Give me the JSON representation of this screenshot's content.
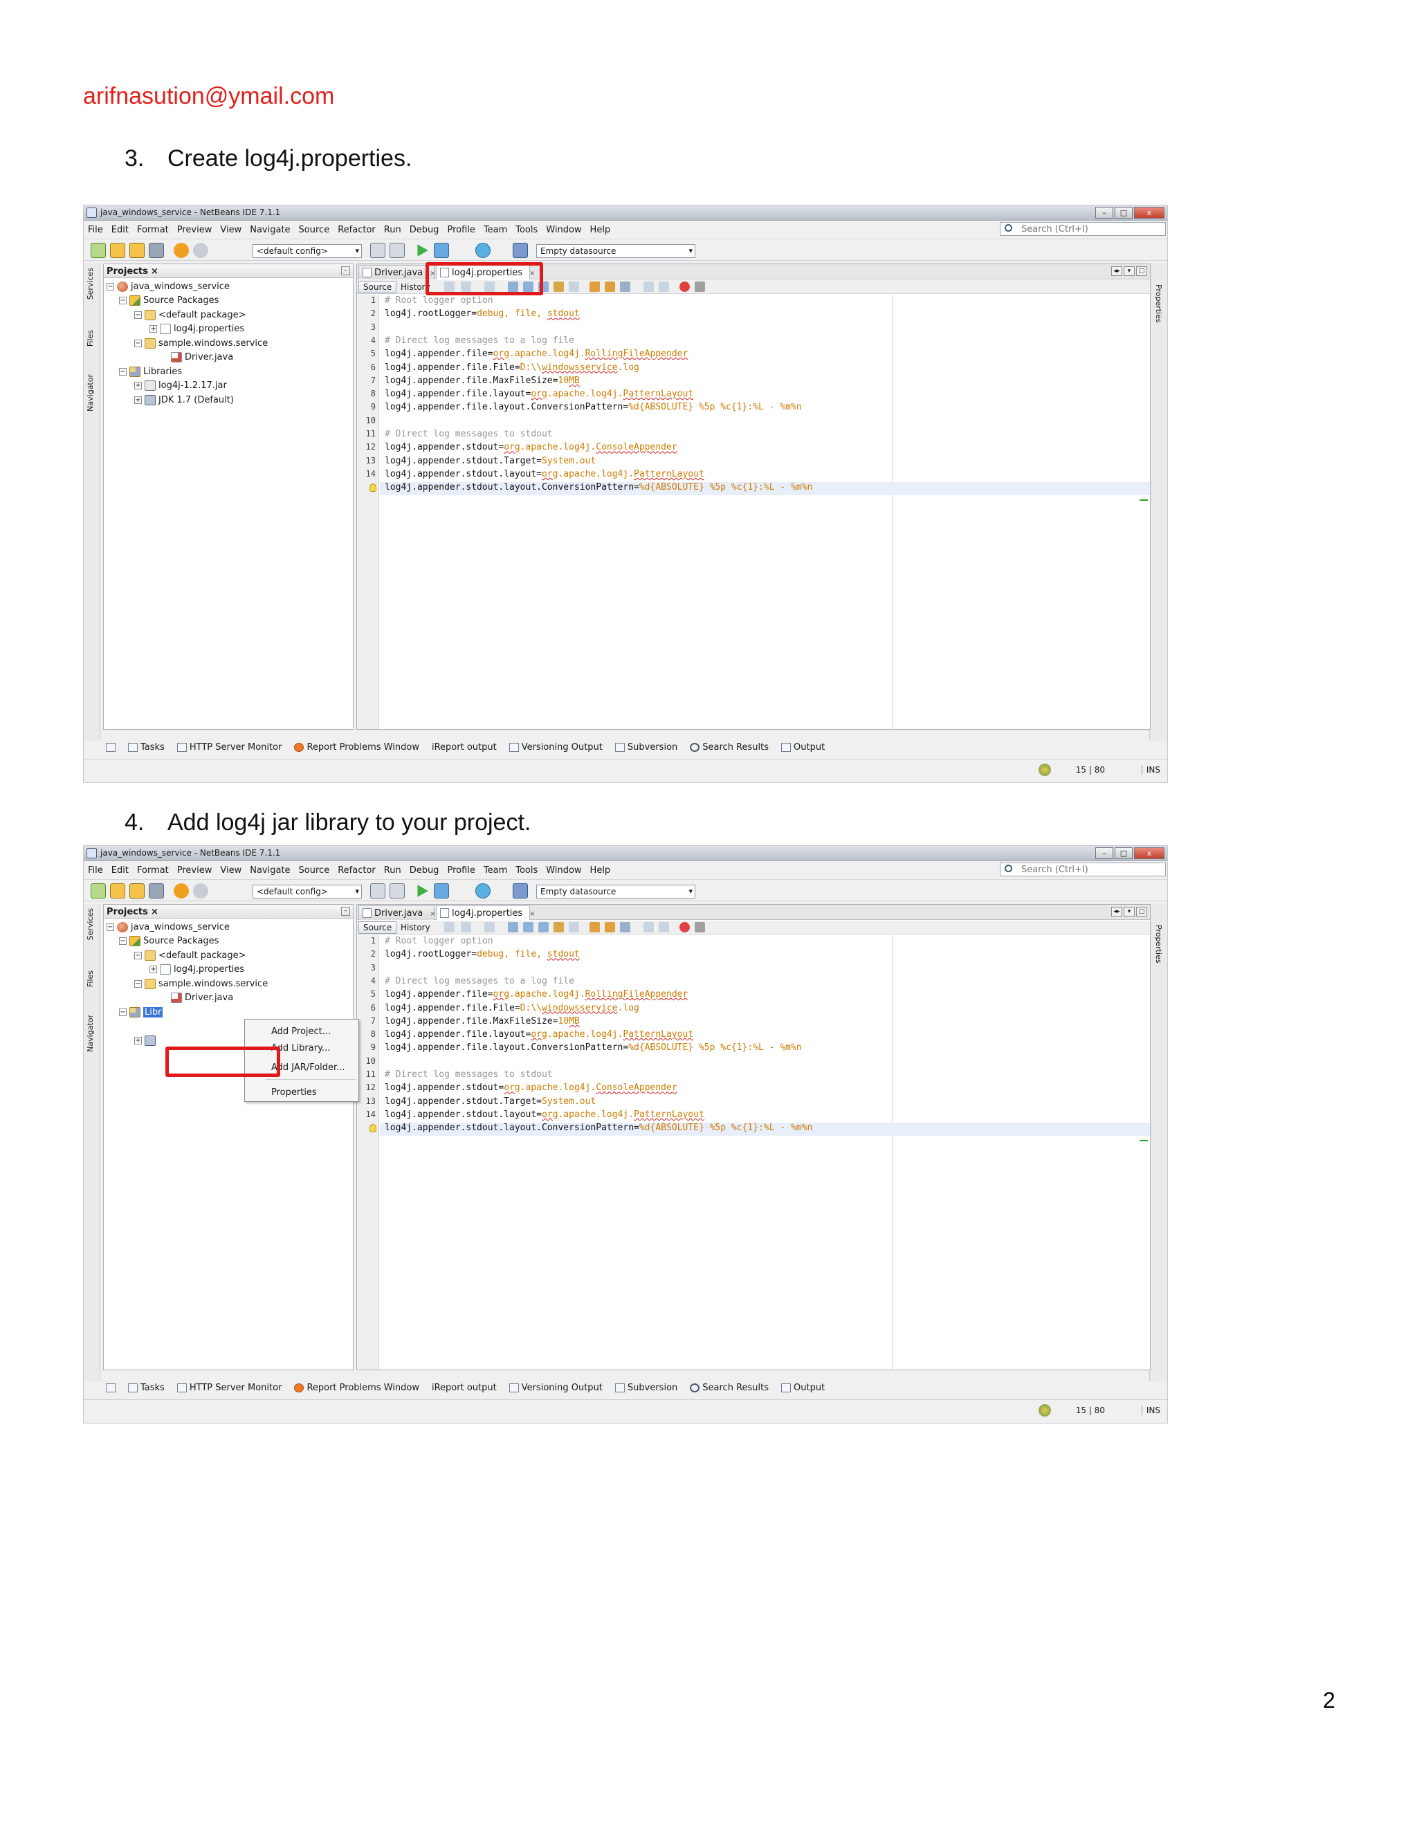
{
  "document": {
    "email": "arifnasution@ymail.com",
    "page_number": "2",
    "steps": [
      {
        "number": "3.",
        "text": "Create log4j.properties."
      },
      {
        "number": "4.",
        "text": "Add log4j jar library to your project."
      }
    ]
  },
  "ide": {
    "window_title": "java_windows_service - NetBeans IDE 7.1.1",
    "window_buttons": {
      "minimize": "–",
      "maximize": "□",
      "close": "x"
    },
    "menu": [
      "File",
      "Edit",
      "Format",
      "Preview",
      "View",
      "Navigate",
      "Source",
      "Refactor",
      "Run",
      "Debug",
      "Profile",
      "Team",
      "Tools",
      "Window",
      "Help"
    ],
    "search_placeholder": "Search (Ctrl+I)",
    "config_combo": "<default config>",
    "datasource_combo": "Empty datasource",
    "side_labels": {
      "services": "Services",
      "files": "Files",
      "navigator": "Navigator",
      "properties": "Properties"
    },
    "projects_tab": "Projects",
    "projects_tab_close": "×",
    "tree": {
      "project": "java_windows_service",
      "source_packages": "Source Packages",
      "default_package": "<default package>",
      "properties_file": "log4j.properties",
      "sample_package": "sample.windows.service",
      "driver": "Driver.java",
      "libraries": "Libraries",
      "libraries_selected": "Libr",
      "jar": "log4j-1.2.17.jar",
      "jdk": "JDK 1.7 (Default)"
    },
    "editor_tabs": [
      "Driver.java",
      "log4j.properties"
    ],
    "tab_close": "×",
    "source_button": "Source",
    "history_button": "History",
    "code_lines": [
      {
        "n": "1",
        "segments": [
          {
            "t": "# Root logger option",
            "c": "comment"
          }
        ]
      },
      {
        "n": "2",
        "segments": [
          {
            "t": "log4j.rootLogger=",
            "c": ""
          },
          {
            "t": "debug, file, ",
            "c": "val"
          },
          {
            "t": "stdout",
            "c": "val u"
          }
        ]
      },
      {
        "n": "3",
        "segments": []
      },
      {
        "n": "4",
        "segments": [
          {
            "t": "# Direct log messages to a log file",
            "c": "comment"
          }
        ]
      },
      {
        "n": "5",
        "segments": [
          {
            "t": "log4j.appender.file=",
            "c": ""
          },
          {
            "t": "org",
            "c": "val u"
          },
          {
            "t": ".apache.log4j.",
            "c": "val"
          },
          {
            "t": "RollingFileAppender",
            "c": "val u"
          }
        ]
      },
      {
        "n": "6",
        "segments": [
          {
            "t": "log4j.appender.file.File=",
            "c": ""
          },
          {
            "t": "D:\\\\",
            "c": "val"
          },
          {
            "t": "windowsservice",
            "c": "val u"
          },
          {
            "t": ".log",
            "c": "val"
          }
        ]
      },
      {
        "n": "7",
        "segments": [
          {
            "t": "log4j.appender.file.MaxFileSize=",
            "c": ""
          },
          {
            "t": "10",
            "c": "val"
          },
          {
            "t": "MB",
            "c": "val u"
          }
        ]
      },
      {
        "n": "8",
        "segments": [
          {
            "t": "log4j.appender.file.layout=",
            "c": ""
          },
          {
            "t": "org",
            "c": "val u"
          },
          {
            "t": ".apache.log4j.",
            "c": "val"
          },
          {
            "t": "PatternLayout",
            "c": "val u"
          }
        ]
      },
      {
        "n": "9",
        "segments": [
          {
            "t": "log4j.appender.file.layout.ConversionPattern=",
            "c": ""
          },
          {
            "t": "%d{ABSOLUTE} %5p %c{1}:%L - %m%n",
            "c": "val"
          }
        ]
      },
      {
        "n": "10",
        "segments": []
      },
      {
        "n": "11",
        "segments": [
          {
            "t": "# Direct log messages to stdout",
            "c": "comment"
          }
        ]
      },
      {
        "n": "12",
        "segments": [
          {
            "t": "log4j.appender.stdout=",
            "c": ""
          },
          {
            "t": "org",
            "c": "val u"
          },
          {
            "t": ".apache.log4j.",
            "c": "val"
          },
          {
            "t": "ConsoleAppender",
            "c": "val u"
          }
        ]
      },
      {
        "n": "13",
        "segments": [
          {
            "t": "log4j.appender.stdout.Target=",
            "c": ""
          },
          {
            "t": "System.out",
            "c": "val"
          }
        ]
      },
      {
        "n": "14",
        "segments": [
          {
            "t": "log4j.appender.stdout.layout=",
            "c": ""
          },
          {
            "t": "org",
            "c": "val u"
          },
          {
            "t": ".apache.log4j.",
            "c": "val"
          },
          {
            "t": "PatternLayout",
            "c": "val u"
          }
        ]
      },
      {
        "n": "",
        "segments": [
          {
            "t": "log4j.appender.stdout.layout.ConversionPattern=",
            "c": ""
          },
          {
            "t": "%d{ABSOLUTE} %5p %c{1}:%L - %m%n",
            "c": "val"
          }
        ]
      }
    ],
    "output_tabs": [
      "Tasks",
      "HTTP Server Monitor",
      "Report Problems Window",
      "iReport output",
      "Versioning Output",
      "Subversion",
      "Search Results",
      "Output"
    ],
    "status_position": "15 | 80",
    "status_mode": "INS",
    "context_menu": [
      "Add Project...",
      "Add Library...",
      "Add JAR/Folder...",
      "Properties"
    ],
    "colors": {
      "highlight": "#e01a1a",
      "selection": "#3875d7",
      "property_value": "#ce7b00",
      "comment": "#969696"
    }
  }
}
